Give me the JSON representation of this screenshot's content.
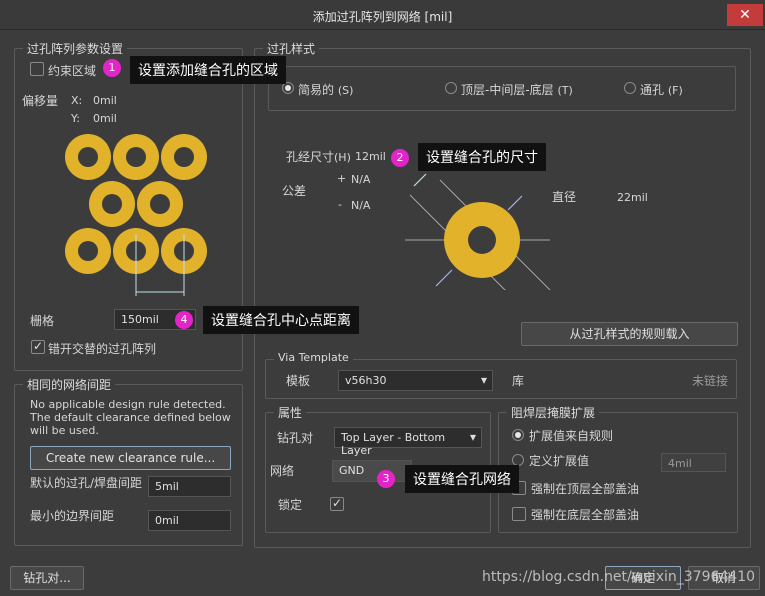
{
  "window": {
    "title": "添加过孔阵列到网络 [mil]",
    "close": "✕"
  },
  "left": {
    "array_group": "过孔阵列参数设置",
    "constrain_label": "约束区域",
    "offset_label": "偏移量",
    "offset_x_label": "X:",
    "offset_x": "0mil",
    "offset_y_label": "Y:",
    "offset_y": "0mil",
    "grid_label": "栅格",
    "grid_value": "150mil",
    "stagger_label": "错开交替的过孔阵列",
    "clearance_group": "相同的网络间距",
    "clearance_msg_1": "No applicable design rule detected.",
    "clearance_msg_2": "The default clearance defined below",
    "clearance_msg_3": "will be used.",
    "create_rule": "Create new clearance rule...",
    "via_pad_label": "默认的过孔/焊盘间距",
    "via_pad_value": "5mil",
    "min_edge_label": "最小的边界间距",
    "min_edge_value": "0mil"
  },
  "right": {
    "style_group": "过孔样式",
    "style_simple": "简易的",
    "style_simple_key": "(S)",
    "style_top_mid_bottom": "顶层-中间层-底层",
    "style_top_mid_bottom_key": "(T)",
    "style_through": "通孔",
    "style_through_key": "(F)",
    "hole_size_label": "孔经尺寸",
    "hole_size_key": "(H)",
    "hole_size_value": "12mil",
    "tolerance_label": "公差",
    "tol_plus": "+",
    "tol_plus_value": "N/A",
    "tol_minus": "-",
    "tol_minus_value": "N/A",
    "diameter_label": "直径",
    "diameter_value": "22mil",
    "load_rule_button": "从过孔样式的规则载入",
    "via_template_group": "Via Template",
    "template_label": "模板",
    "template_value": "v56h30",
    "library_label": "库",
    "library_status": "未链接",
    "props_group": "属性",
    "drill_pair_label": "钻孔对",
    "drill_pair_value": "Top Layer - Bottom Layer",
    "net_label": "网络",
    "net_value": "GND",
    "lock_label": "锁定",
    "mask_group": "阻焊层掩膜扩展",
    "mask_rule": "扩展值来自规则",
    "mask_custom": "定义扩展值",
    "mask_custom_value": "4mil",
    "force_top": "强制在顶层全部盖油",
    "force_bottom": "强制在底层全部盖油"
  },
  "footer": {
    "drill_pairs_button": "钻孔对...",
    "ok_button": "确定",
    "cancel_button": "取消"
  },
  "annotations": {
    "badge_1": "1",
    "callout_1": "设置添加缝合孔的区域",
    "badge_2": "2",
    "callout_2": "设置缝合孔的尺寸",
    "badge_3": "3",
    "callout_3": "设置缝合孔网络",
    "badge_4": "4",
    "callout_4": "设置缝合孔中心点距离"
  },
  "watermark": "https://blog.csdn.net/weixin_37964410",
  "colors": {
    "via_gold": "#e2b22b",
    "badge": "#e324c9",
    "close": "#c43b3b"
  }
}
